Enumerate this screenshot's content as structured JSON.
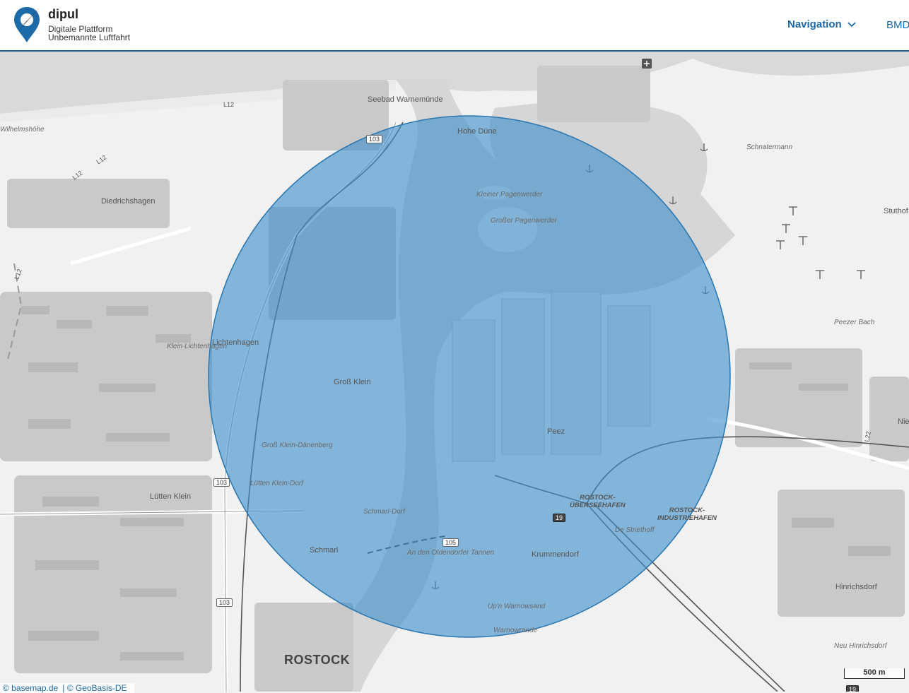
{
  "header": {
    "brand_name": "dipul",
    "brand_sub1": "Digitale Plattform",
    "brand_sub2": "Unbemannte Luftfahrt",
    "nav_label": "Navigation",
    "nav_icon": "chevron-down-icon",
    "bmd_label": "BMD"
  },
  "colors": {
    "accent": "#1c6aa7",
    "zone_fill": "#3d8fc9",
    "zone_stroke": "#2a76b0"
  },
  "map": {
    "city_label": "ROSTOCK",
    "places": [
      "Seebad Warnemünde",
      "Hohe Düne",
      "Schnatermann",
      "Diedrichshagen",
      "Wilhelmshöhe",
      "Lichtenhagen",
      "Klein Lichtenhagen",
      "Groß Klein",
      "Groß Klein-Dänenberg",
      "Lütten Klein-Dorf",
      "Lütten Klein",
      "Schmarl",
      "Schmarl-Dorf",
      "An den Oldendorfer Tannen",
      "Peez",
      "Krummendorf",
      "Up'n Warnowsand",
      "Warnowrande",
      "Hinrichsdorf",
      "Neu Hinrichsdorf",
      "Stuthof",
      "Nie",
      "Kleiner Pagenwerder",
      "Großer Pagenwerder",
      "Peezer Bach",
      "De Striethoff"
    ],
    "port_labels": [
      "ROSTOCK-\nÜBERSEEHAFEN",
      "ROSTOCK-\nINDUSTRIEHAFEN"
    ],
    "road_shields": [
      "103",
      "103",
      "103",
      "105",
      "19",
      "19",
      "L12",
      "L12",
      "L12",
      "L12",
      "L22"
    ],
    "scale_label": "500 m",
    "zone_type": "circle"
  },
  "attribution": [
    "© basemap.de",
    "© GeoBasis-DE"
  ]
}
